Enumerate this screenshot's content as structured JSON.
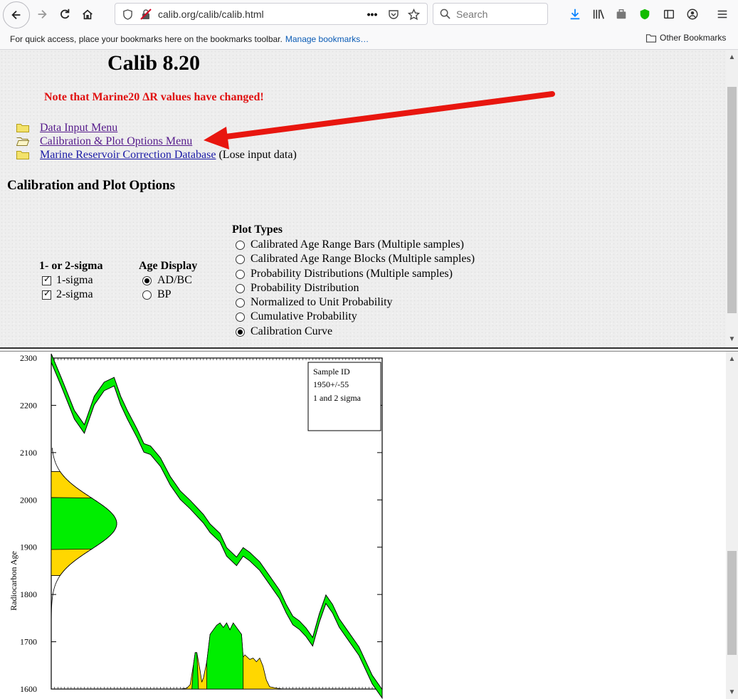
{
  "browser": {
    "url": "calib.org/calib/calib.html",
    "search_placeholder": "Search",
    "bookmarks_message": "For quick access, place your bookmarks here on the bookmarks toolbar.",
    "manage_bookmarks": "Manage bookmarks…",
    "other_bookmarks": "Other Bookmarks"
  },
  "page": {
    "heading": "Calib 8.20",
    "note": "Note that Marine20 ΔR values have changed!",
    "menu": [
      {
        "label": "Data Input Menu",
        "suffix": ""
      },
      {
        "label": "Calibration & Plot Options Menu",
        "suffix": ""
      },
      {
        "label": "Marine Reservoir Correction Database",
        "suffix": "(Lose input data)"
      }
    ],
    "section_heading": "Calibration and Plot Options",
    "sigma": {
      "title": "1- or 2-sigma",
      "options": [
        {
          "label": "1-sigma",
          "checked": true
        },
        {
          "label": "2-sigma",
          "checked": true
        }
      ]
    },
    "age_display": {
      "title": "Age Display",
      "options": [
        {
          "label": "AD/BC",
          "selected": true
        },
        {
          "label": "BP",
          "selected": false
        }
      ]
    },
    "plot_types": {
      "title": "Plot Types",
      "options": [
        {
          "label": "Calibrated Age Range Bars (Multiple samples)",
          "selected": false
        },
        {
          "label": "Calibrated Age Range Blocks (Multiple samples)",
          "selected": false
        },
        {
          "label": "Probability Distributions (Multiple samples)",
          "selected": false
        },
        {
          "label": "Probability Distribution",
          "selected": false
        },
        {
          "label": "Normalized to Unit Probability",
          "selected": false
        },
        {
          "label": "Cumulative Probability",
          "selected": false
        },
        {
          "label": "Calibration Curve",
          "selected": true
        }
      ]
    },
    "annotation_arrow_color": "#e8160f"
  },
  "chart_data": {
    "type": "line",
    "ylabel": "Radiocarbon Age",
    "ylim": [
      1600,
      2300
    ],
    "yticks": [
      2300,
      2200,
      2100,
      2000,
      1900,
      1800,
      1700,
      1600
    ],
    "legend": [
      "Sample ID",
      "1950+/-55",
      "1 and 2 sigma"
    ],
    "sample": {
      "age": 1950,
      "error": 55
    },
    "colors": {
      "curve": "#00ee00",
      "one_sigma": "#00ee00",
      "two_sigma": "#ffd700",
      "outline": "#000000"
    },
    "calibration_curve": {
      "x_frac": [
        0.0,
        0.03,
        0.07,
        0.1,
        0.13,
        0.16,
        0.19,
        0.21,
        0.23,
        0.26,
        0.28,
        0.3,
        0.33,
        0.36,
        0.39,
        0.42,
        0.44,
        0.46,
        0.48,
        0.51,
        0.53,
        0.56,
        0.58,
        0.6,
        0.63,
        0.66,
        0.69,
        0.71,
        0.73,
        0.75,
        0.77,
        0.79,
        0.81,
        0.83,
        0.85,
        0.87,
        0.89,
        0.91,
        0.93,
        0.95,
        0.97,
        1.0
      ],
      "y": [
        2300,
        2250,
        2180,
        2150,
        2210,
        2240,
        2250,
        2210,
        2180,
        2140,
        2110,
        2105,
        2080,
        2040,
        2010,
        1990,
        1975,
        1960,
        1940,
        1920,
        1890,
        1870,
        1890,
        1880,
        1860,
        1830,
        1800,
        1770,
        1745,
        1735,
        1720,
        1700,
        1750,
        1790,
        1770,
        1740,
        1720,
        1700,
        1680,
        1650,
        1620,
        1590
      ]
    }
  }
}
